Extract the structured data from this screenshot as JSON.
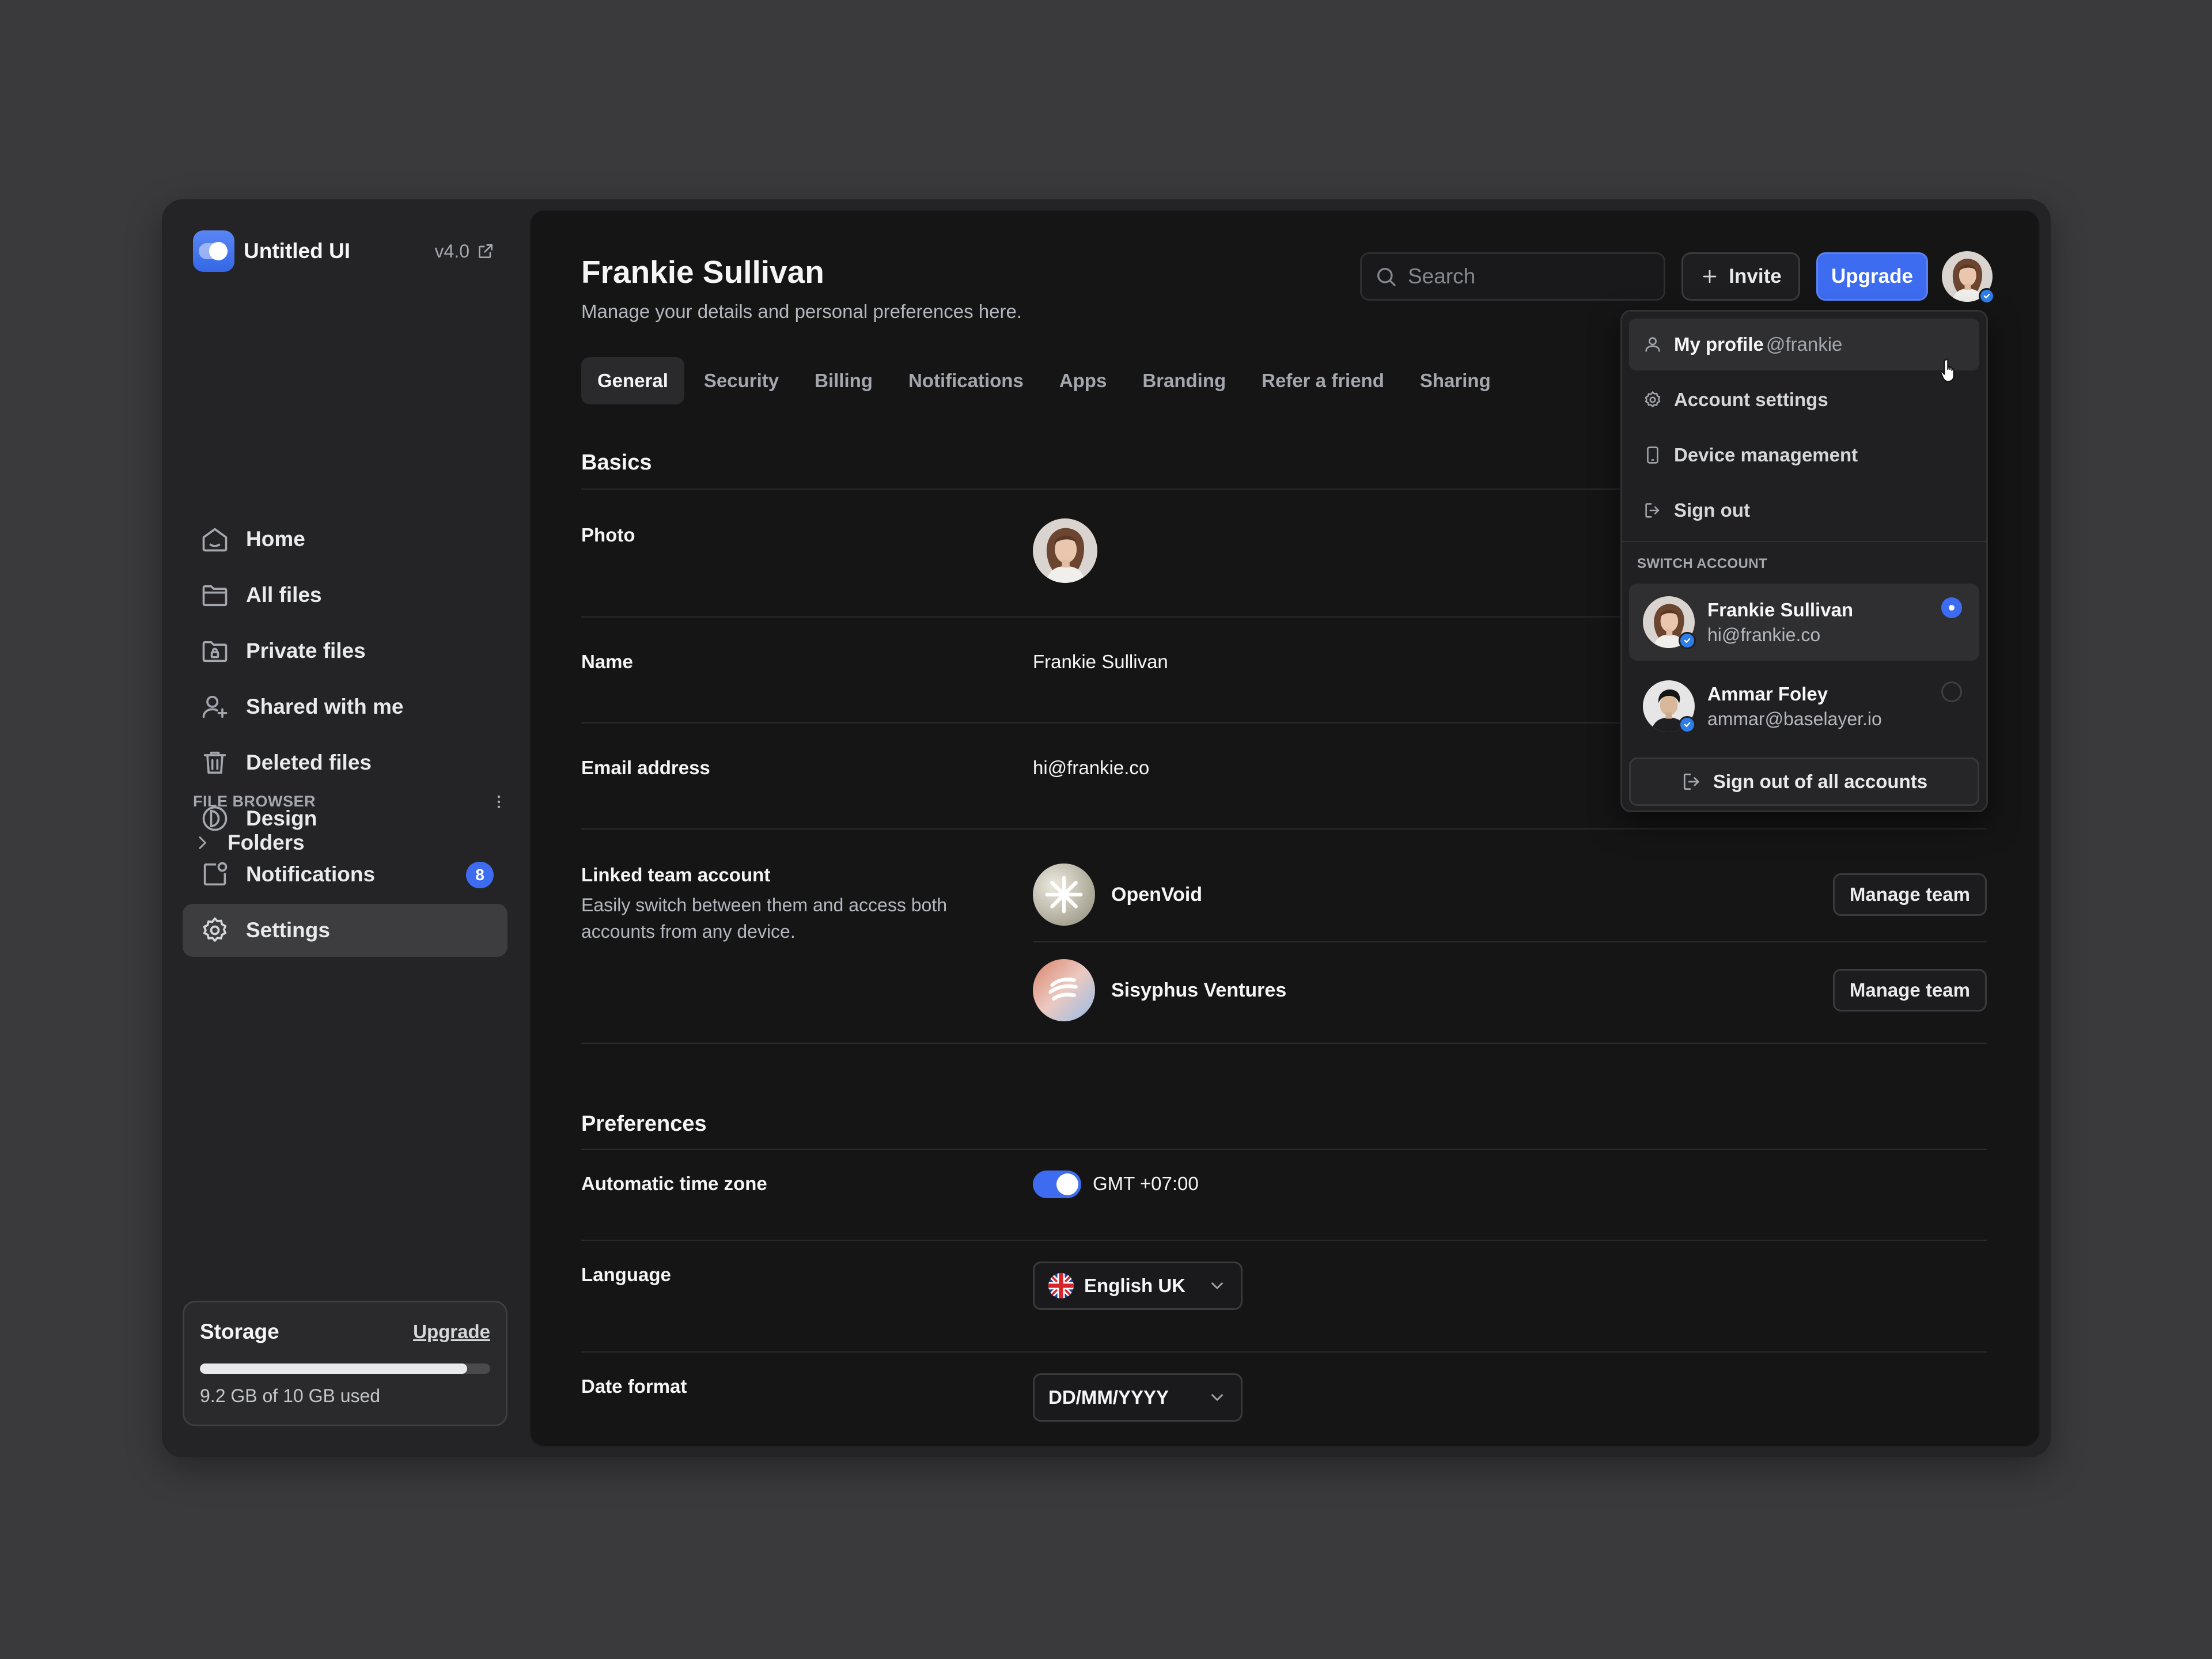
{
  "brand": {
    "name": "Untitled UI",
    "version": "v4.0"
  },
  "sidebar": {
    "items": [
      {
        "label": "Home",
        "icon": "home-icon"
      },
      {
        "label": "All files",
        "icon": "folder-icon"
      },
      {
        "label": "Private files",
        "icon": "folder-lock-icon"
      },
      {
        "label": "Shared with me",
        "icon": "user-plus-icon"
      },
      {
        "label": "Deleted files",
        "icon": "trash-icon"
      },
      {
        "label": "Design",
        "icon": "design-icon"
      },
      {
        "label": "Notifications",
        "icon": "notification-icon",
        "badge": "8"
      },
      {
        "label": "Settings",
        "icon": "gear-icon",
        "active": true
      }
    ],
    "file_browser": {
      "title": "FILE BROWSER",
      "folders_label": "Folders"
    },
    "storage": {
      "title": "Storage",
      "upgrade": "Upgrade",
      "used_text": "9.2 GB of 10 GB used",
      "used_fraction": 0.92
    }
  },
  "header": {
    "title": "Frankie Sullivan",
    "subtitle": "Manage your details and personal preferences here.",
    "search_placeholder": "Search",
    "invite_label": "Invite",
    "upgrade_label": "Upgrade"
  },
  "tabs": [
    "General",
    "Security",
    "Billing",
    "Notifications",
    "Apps",
    "Branding",
    "Refer a friend",
    "Sharing"
  ],
  "basics": {
    "title": "Basics",
    "photo_label": "Photo",
    "name_label": "Name",
    "name_value": "Frankie Sullivan",
    "email_label": "Email address",
    "email_value": "hi@frankie.co",
    "linked_label": "Linked team account",
    "linked_desc": "Easily switch between them and access both accounts from any device.",
    "teams": [
      {
        "name": "OpenVoid",
        "button": "Manage team"
      },
      {
        "name": "Sisyphus Ventures",
        "button": "Manage team"
      }
    ]
  },
  "preferences": {
    "title": "Preferences",
    "timezone_label": "Automatic time zone",
    "timezone_value": "GMT +07:00",
    "timezone_enabled": true,
    "language_label": "Language",
    "language_value": "English UK",
    "date_label": "Date format",
    "date_value": "DD/MM/YYYY"
  },
  "dropdown": {
    "profile_label": "My profile",
    "profile_handle": "@frankie",
    "items": [
      "Account settings",
      "Device management",
      "Sign out"
    ],
    "switch_title": "SWITCH ACCOUNT",
    "accounts": [
      {
        "name": "Frankie Sullivan",
        "email": "hi@frankie.co",
        "selected": true
      },
      {
        "name": "Ammar Foley",
        "email": "ammar@baselayer.io",
        "selected": false
      }
    ],
    "signout_all": "Sign out of all accounts"
  },
  "colors": {
    "accent": "#3e6cf0",
    "background": "#151516",
    "sidebar": "#242426",
    "page": "#3a3a3c"
  }
}
